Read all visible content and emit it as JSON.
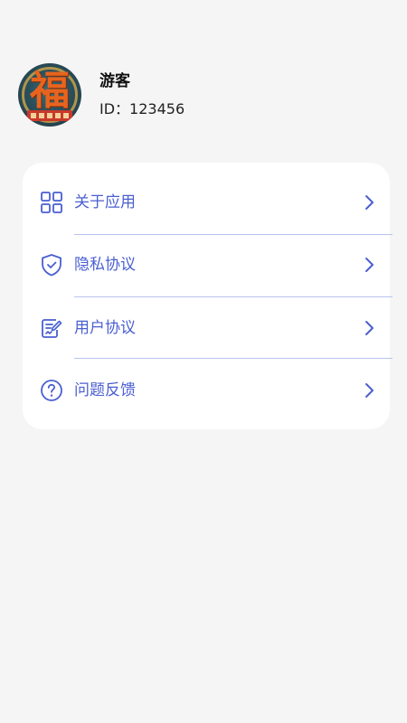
{
  "profile": {
    "name": "游客",
    "id_text": "ID：123456"
  },
  "menu": {
    "items": [
      {
        "label": "关于应用",
        "icon": "grid-apps-icon"
      },
      {
        "label": "隐私协议",
        "icon": "shield-check-icon"
      },
      {
        "label": "用户协议",
        "icon": "document-edit-icon"
      },
      {
        "label": "问题反馈",
        "icon": "question-circle-icon"
      }
    ]
  },
  "colors": {
    "background": "#f5f5f5",
    "card": "#ffffff",
    "accent": "#4a5fd1",
    "divider": "#b9c3ee"
  }
}
